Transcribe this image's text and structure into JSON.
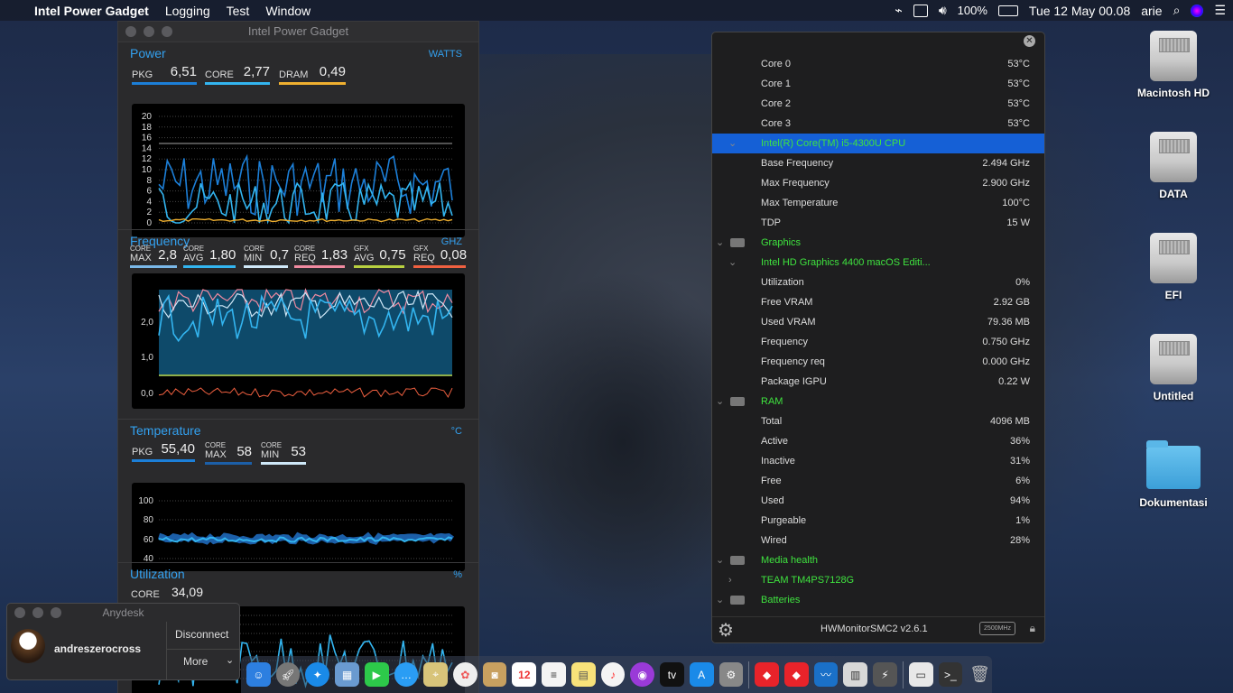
{
  "menubar": {
    "apple": "",
    "app_name": "Intel Power Gadget",
    "menus": [
      "Logging",
      "Test",
      "Window"
    ],
    "battery": "100%",
    "datetime": "Tue 12 May  00.08",
    "user": "arie"
  },
  "ipg": {
    "title": "Intel Power Gadget",
    "power": {
      "title": "Power",
      "unit": "WATTS",
      "metrics": [
        {
          "label": "PKG",
          "value": "6,51"
        },
        {
          "label": "CORE",
          "value": "2,77"
        },
        {
          "label": "DRAM",
          "value": "0,49"
        }
      ],
      "yticks": [
        "20",
        "18",
        "16",
        "14",
        "12",
        "10",
        "8",
        "6",
        "4",
        "2",
        "0"
      ]
    },
    "frequency": {
      "title": "Frequency",
      "unit": "GHZ",
      "metrics": [
        {
          "top": "CORE",
          "bot": "MAX",
          "value": "2,8"
        },
        {
          "top": "CORE",
          "bot": "AVG",
          "value": "1,80"
        },
        {
          "top": "CORE",
          "bot": "MIN",
          "value": "0,7"
        },
        {
          "top": "CORE",
          "bot": "REQ",
          "value": "1,83"
        },
        {
          "top": "GFX",
          "bot": "AVG",
          "value": "0,75"
        },
        {
          "top": "GFX",
          "bot": "REQ",
          "value": "0,08"
        }
      ],
      "yticks": [
        "2,0",
        "1,0",
        "0,0"
      ]
    },
    "temperature": {
      "title": "Temperature",
      "unit": "°C",
      "metrics": [
        {
          "label": "PKG",
          "value": "55,40"
        },
        {
          "top": "CORE",
          "bot": "MAX",
          "value": "58"
        },
        {
          "top": "CORE",
          "bot": "MIN",
          "value": "53"
        }
      ],
      "yticks": [
        "100",
        "80",
        "60",
        "40"
      ]
    },
    "utilization": {
      "title": "Utilization",
      "unit": "%",
      "metrics": [
        {
          "label": "CORE",
          "value": "34,09"
        }
      ]
    }
  },
  "hwm": {
    "rows": [
      {
        "k": "Core 0",
        "v": "53°C"
      },
      {
        "k": "Core 1",
        "v": "53°C"
      },
      {
        "k": "Core 2",
        "v": "53°C"
      },
      {
        "k": "Core 3",
        "v": "53°C"
      },
      {
        "k": "Intel(R) Core(TM) i5-4300U CPU",
        "v": "",
        "group": true,
        "sel": true,
        "chev": "⌄"
      },
      {
        "k": "Base Frequency",
        "v": "2.494 GHz"
      },
      {
        "k": "Max Frequency",
        "v": "2.900 GHz"
      },
      {
        "k": "Max Temperature",
        "v": "100°C"
      },
      {
        "k": "TDP",
        "v": "15 W"
      },
      {
        "k": "Graphics",
        "v": "",
        "group": true,
        "chev": "⌄",
        "icon": true
      },
      {
        "k": "Intel HD Graphics 4400 macOS Editi...",
        "v": "",
        "group": true,
        "chev": "⌄"
      },
      {
        "k": "Utilization",
        "v": "0%"
      },
      {
        "k": "Free VRAM",
        "v": "2.92 GB"
      },
      {
        "k": "Used VRAM",
        "v": "79.36 MB"
      },
      {
        "k": "Frequency",
        "v": "0.750 GHz"
      },
      {
        "k": "Frequency req",
        "v": "0.000 GHz"
      },
      {
        "k": "Package IGPU",
        "v": "0.22 W"
      },
      {
        "k": "RAM",
        "v": "",
        "group": true,
        "chev": "⌄",
        "icon": true
      },
      {
        "k": "Total",
        "v": "4096 MB"
      },
      {
        "k": "Active",
        "v": "36%"
      },
      {
        "k": "Inactive",
        "v": "31%"
      },
      {
        "k": "Free",
        "v": "6%"
      },
      {
        "k": "Used",
        "v": "94%"
      },
      {
        "k": "Purgeable",
        "v": "1%"
      },
      {
        "k": "Wired",
        "v": "28%"
      },
      {
        "k": "Media health",
        "v": "",
        "group": true,
        "chev": "⌄",
        "icon": true
      },
      {
        "k": "TEAM TM4PS7128G",
        "v": "",
        "group": true,
        "chev": "›"
      },
      {
        "k": "Batteries",
        "v": "",
        "group": true,
        "chev": "⌄",
        "icon": true
      }
    ],
    "footer_title": "HWMonitorSMC2 v2.6.1",
    "footer_badge": "2500MHz"
  },
  "desktop": [
    "Macintosh HD",
    "DATA",
    "EFI",
    "Untitled",
    "Dokumentasi"
  ],
  "anydesk": {
    "title": "Anydesk",
    "user": "andreszerocross",
    "disconnect": "Disconnect",
    "more": "More"
  },
  "dock": {
    "calendar_day": "12"
  },
  "colors": {
    "accent": "#33a1f0",
    "green": "#3fe33f",
    "selected": "#1560d6"
  }
}
